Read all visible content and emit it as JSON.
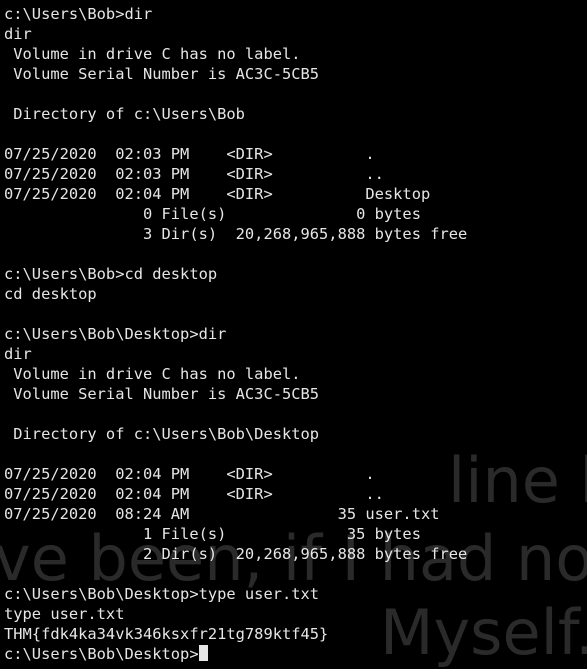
{
  "wallpaper": {
    "line1": "line how \"normal\"",
    "line2": "ve been, if I had not",
    "line3": "Myself."
  },
  "terminal": {
    "lines": [
      "c:\\Users\\Bob>dir",
      "dir",
      " Volume in drive C has no label.",
      " Volume Serial Number is AC3C-5CB5",
      "",
      " Directory of c:\\Users\\Bob",
      "",
      "07/25/2020  02:03 PM    <DIR>          .",
      "07/25/2020  02:03 PM    <DIR>          ..",
      "07/25/2020  02:04 PM    <DIR>          Desktop",
      "               0 File(s)              0 bytes",
      "               3 Dir(s)  20,268,965,888 bytes free",
      "",
      "c:\\Users\\Bob>cd desktop",
      "cd desktop",
      "",
      "c:\\Users\\Bob\\Desktop>dir",
      "dir",
      " Volume in drive C has no label.",
      " Volume Serial Number is AC3C-5CB5",
      "",
      " Directory of c:\\Users\\Bob\\Desktop",
      "",
      "07/25/2020  02:04 PM    <DIR>          .",
      "07/25/2020  02:04 PM    <DIR>          ..",
      "07/25/2020  08:24 AM                35 user.txt",
      "               1 File(s)             35 bytes",
      "               2 Dir(s)  20,268,965,888 bytes free",
      "",
      "c:\\Users\\Bob\\Desktop>type user.txt",
      "type user.txt",
      "THM{fdk4ka34vk346ksxfr21tg789ktf45}"
    ],
    "prompt": "c:\\Users\\Bob\\Desktop>"
  }
}
